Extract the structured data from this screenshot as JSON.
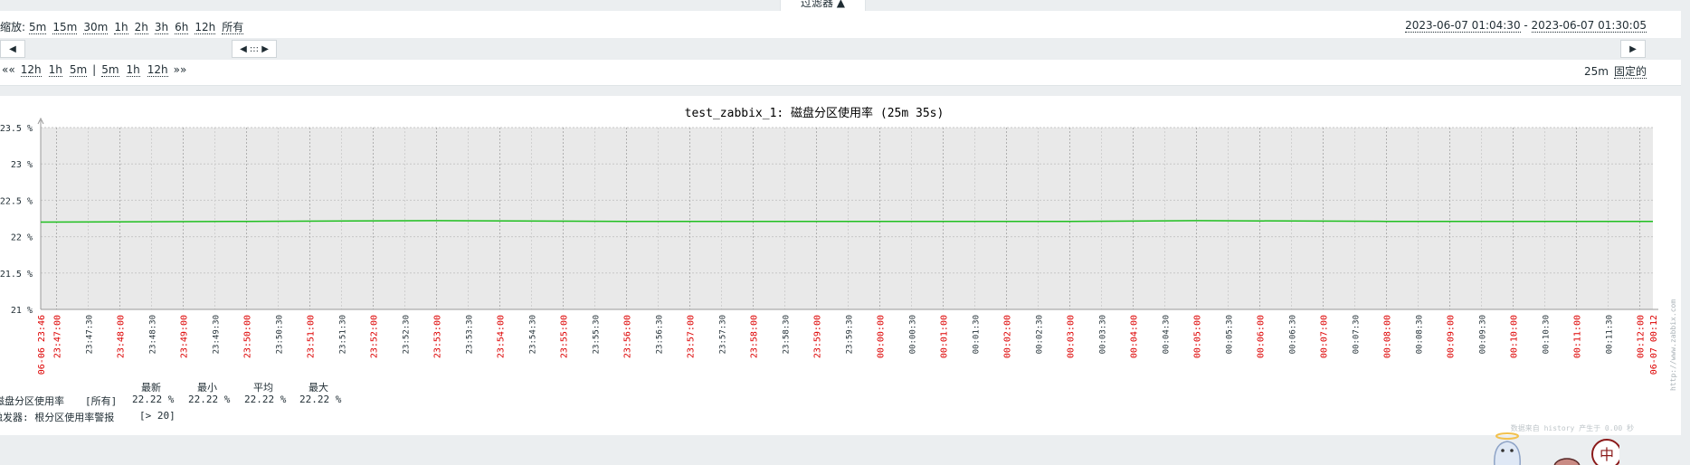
{
  "filter": {
    "label": "过滤器 ▲"
  },
  "zoom": {
    "label": "缩放:",
    "options": [
      "5m",
      "15m",
      "30m",
      "1h",
      "2h",
      "3h",
      "6h",
      "12h",
      "所有"
    ]
  },
  "date_range": {
    "start": "2023-06-07 01:04:30",
    "separator": " - ",
    "end": "2023-06-07 01:30:05"
  },
  "slider": {
    "left_arrow": "◀",
    "handle": "◀ ::: ▶",
    "right_arrow": "▶"
  },
  "nav": {
    "back_all": "««",
    "back": [
      "12h",
      "1h",
      "5m"
    ],
    "divider": "|",
    "forward": [
      "5m",
      "1h",
      "12h"
    ],
    "forward_all": "»»",
    "period": "25m",
    "fixed": "固定的"
  },
  "chart_data": {
    "type": "line",
    "title": "test_zabbix_1: 磁盘分区使用率 (25m 35s)",
    "y_ticks": [
      "23.5 %",
      "23 %",
      "22.5 %",
      "22 %",
      "21.5 %",
      "21 %"
    ],
    "ylim": [
      21,
      23.5
    ],
    "y_unit": "%",
    "x_start_label": "06-06 23:46",
    "x_end_label": "06-07 00:12",
    "x_ticks": [
      "23:47:00",
      "23:47:30",
      "23:48:00",
      "23:48:30",
      "23:49:00",
      "23:49:30",
      "23:50:00",
      "23:50:30",
      "23:51:00",
      "23:51:30",
      "23:52:00",
      "23:52:30",
      "23:53:00",
      "23:53:30",
      "23:54:00",
      "23:54:30",
      "23:55:00",
      "23:55:30",
      "23:56:00",
      "23:56:30",
      "23:57:00",
      "23:57:30",
      "23:58:00",
      "23:58:30",
      "23:59:00",
      "23:59:30",
      "00:00:00",
      "00:00:30",
      "00:01:00",
      "00:01:30",
      "00:02:00",
      "00:02:30",
      "00:03:00",
      "00:03:30",
      "00:04:00",
      "00:04:30",
      "00:05:00",
      "00:05:30",
      "00:06:00",
      "00:06:30",
      "00:07:00",
      "00:07:30",
      "00:08:00",
      "00:08:30",
      "00:09:00",
      "00:09:30",
      "00:10:00",
      "00:10:30",
      "00:11:00",
      "00:11:30",
      "00:12:00"
    ],
    "grid": true,
    "series": [
      {
        "name": "磁盘分区使用率",
        "color": "#1fbf1f",
        "x": [
          "23:46:10",
          "23:50:00",
          "23:53:00",
          "23:56:00",
          "00:00:00",
          "00:03:00",
          "00:05:00",
          "00:08:00",
          "00:12:20"
        ],
        "values": [
          22.2,
          22.21,
          22.22,
          22.21,
          22.21,
          22.21,
          22.22,
          22.21,
          22.21
        ]
      }
    ],
    "watermark": "http://www.zabbix.com"
  },
  "legend": {
    "headers": [
      "最新",
      "最小",
      "平均",
      "最大"
    ],
    "item_name": "磁盘分区使用率",
    "item_func": "[所有]",
    "values": [
      "22.22 %",
      "22.22 %",
      "22.22 %",
      "22.22 %"
    ],
    "trigger": "触发器: 根分区使用率警报",
    "trigger_cond": "[> 20]"
  },
  "footer": {
    "source": "数据来自 history  产生于 0.00 秒"
  },
  "mascot": {
    "glyph": "中"
  },
  "colors": {
    "accent_red": "#dd0000",
    "series_green": "#1fbf1f",
    "grid_bg": "#e9e9e9"
  }
}
